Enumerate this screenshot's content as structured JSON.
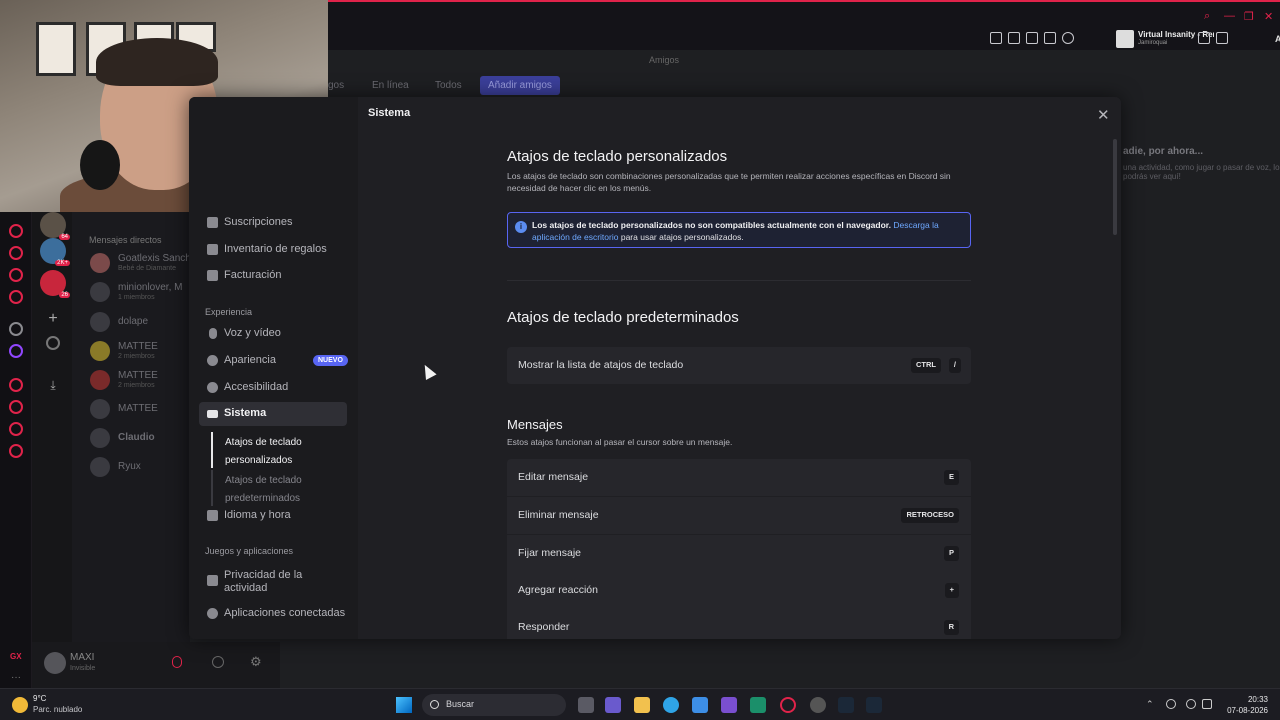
{
  "browser": {
    "media": {
      "title": "Virtual Insanity - Remas",
      "artist": "Jamiroquai"
    },
    "ai_label": "AI",
    "gx_label": "GX"
  },
  "discord": {
    "header_label": "Amigos",
    "friends_tabs": [
      "gos",
      "En línea",
      "Todos"
    ],
    "add_friends": "Añadir amigos",
    "dm_header": "Mensajes directos",
    "dms": [
      {
        "name": "Goatlexis Sanch",
        "sub": "Bebé de Diamante"
      },
      {
        "name": "minionlover, M",
        "sub": "1 miembros"
      },
      {
        "name": "dolape",
        "sub": ""
      },
      {
        "name": "MATTEE",
        "sub": "2 miembros"
      },
      {
        "name": "MATTEE",
        "sub": "2 miembros"
      },
      {
        "name": "MATTEE",
        "sub": ""
      },
      {
        "name": "Claudio",
        "sub": ""
      },
      {
        "name": "Ryux",
        "sub": ""
      }
    ],
    "server_badges": [
      "64",
      "2K+",
      "26"
    ],
    "user": {
      "name": "MAXI",
      "status": "Invisible"
    },
    "right_activity": {
      "title": "adie, por ahora...",
      "text": "una actividad, como jugar o pasar de voz, lo podrás ver aquí!"
    }
  },
  "settings": {
    "title": "Sistema",
    "nav_top": [
      {
        "label": "Suscripciones",
        "icon": "subscriptions-icon"
      },
      {
        "label": "Inventario de regalos",
        "icon": "gift-icon"
      },
      {
        "label": "Facturación",
        "icon": "billing-icon"
      }
    ],
    "section_experience": "Experiencia",
    "nav_experience": [
      {
        "label": "Voz y vídeo",
        "icon": "microphone-icon"
      },
      {
        "label": "Apariencia",
        "icon": "palette-icon",
        "badge": "NUEVO"
      },
      {
        "label": "Accesibilidad",
        "icon": "accessibility-icon"
      },
      {
        "label": "Sistema",
        "icon": "keyboard-icon",
        "active": true
      }
    ],
    "sub_nav": [
      {
        "label": "Atajos de teclado personalizados",
        "active": true
      },
      {
        "label": "Atajos de teclado predeterminados",
        "active": false
      }
    ],
    "nav_language": {
      "label": "Idioma y hora",
      "icon": "language-icon"
    },
    "section_games": "Juegos y aplicaciones",
    "nav_games": [
      {
        "label": "Privacidad de la actividad",
        "icon": "activity-privacy-icon"
      },
      {
        "label": "Aplicaciones conectadas",
        "icon": "link-icon"
      }
    ],
    "custom": {
      "heading": "Atajos de teclado personalizados",
      "description": "Los atajos de teclado son combinaciones personalizadas que te permiten realizar acciones específicas en Discord sin necesidad de hacer clic en los menús.",
      "info_bold": "Los atajos de teclado personalizados no son compatibles actualmente con el navegador.",
      "info_link": "Descarga la aplicación de escritorio",
      "info_tail": "para usar atajos personalizados."
    },
    "defaults": {
      "heading": "Atajos de teclado predeterminados",
      "show_list": {
        "label": "Mostrar la lista de atajos de teclado",
        "keys": [
          "CTRL",
          "/"
        ]
      }
    },
    "messages": {
      "heading": "Mensajes",
      "description": "Estos atajos funcionan al pasar el cursor sobre un mensaje.",
      "rows": [
        {
          "label": "Editar mensaje",
          "key": "E"
        },
        {
          "label": "Eliminar mensaje",
          "key": "RETROCESO"
        },
        {
          "label": "Fijar mensaje",
          "key": "P"
        },
        {
          "label": "Agregar reacción",
          "key": "+"
        },
        {
          "label": "Responder",
          "key": "R"
        }
      ]
    }
  },
  "taskbar": {
    "weather_temp": "9°C",
    "weather_condition": "Parc. nublado",
    "search_label": "Buscar",
    "time": "20:33",
    "date": "07-08-2026"
  }
}
